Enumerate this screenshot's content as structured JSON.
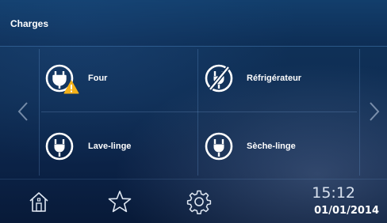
{
  "header": {
    "title": "Charges"
  },
  "nav": {
    "prev_icon": "chevron-left-icon",
    "next_icon": "chevron-right-icon"
  },
  "loads": [
    {
      "label": "Four",
      "icon": "plug-icon",
      "badge": "warning-icon",
      "state": "warning"
    },
    {
      "label": "Réfrigérateur",
      "icon": "plug-off-icon",
      "state": "off"
    },
    {
      "label": "Lave-linge",
      "icon": "plug-icon",
      "state": "on"
    },
    {
      "label": "Sèche-linge",
      "icon": "plug-icon",
      "state": "on"
    }
  ],
  "footer": {
    "home_icon": "home-icon",
    "favorites_icon": "star-icon",
    "settings_icon": "gear-icon",
    "time": "15:12",
    "date": "01/01/2014"
  },
  "colors": {
    "warning": "#f5b21a",
    "accent": "#ffffff"
  }
}
